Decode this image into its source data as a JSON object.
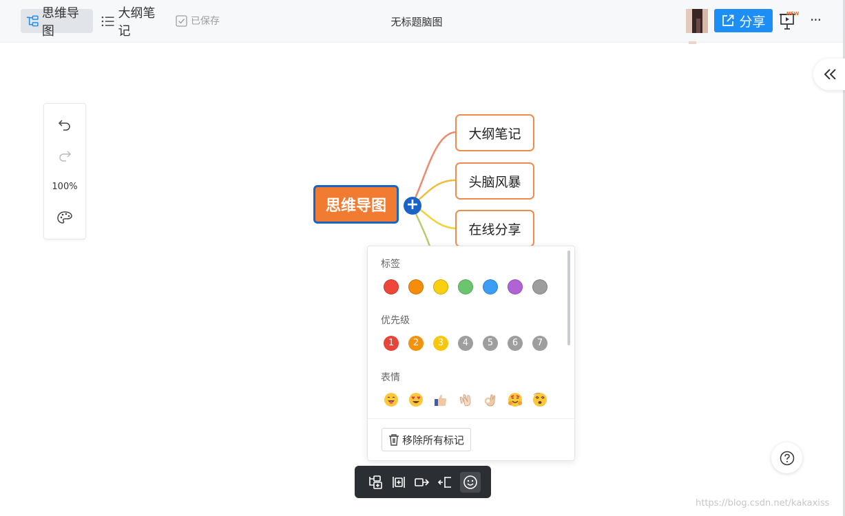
{
  "topbar": {
    "mindmap_tab": "思维导图",
    "outline_tab": "大纲笔记",
    "saved_status": "已保存",
    "doc_title": "无标题脑图",
    "share_label": "分享",
    "new_badge": "NEW",
    "more_label": "···"
  },
  "left_toolbar": {
    "zoom_level": "100%"
  },
  "mindmap": {
    "root": "思维导图",
    "children": [
      "大纲笔记",
      "头脑风暴",
      "在线分享"
    ]
  },
  "marker_panel": {
    "tags_title": "标签",
    "tag_colors": [
      "#f0453a",
      "#f58c0a",
      "#f9cf0f",
      "#6ac66c",
      "#3a9ef5",
      "#b163d6",
      "#9d9d9d"
    ],
    "priority_title": "优先级",
    "priorities": [
      "1",
      "2",
      "3",
      "4",
      "5",
      "6",
      "7"
    ],
    "priority_colors": [
      "#e8453a",
      "#f3920f",
      "#f8c70d",
      "#9e9e9e",
      "#9e9e9e",
      "#9e9e9e",
      "#9e9e9e"
    ],
    "emoji_title": "表情",
    "emojis": [
      "tongue-face-icon",
      "heart-eyes-icon",
      "thumbs-up-icon",
      "clapping-hands-icon",
      "ok-hand-icon",
      "hugging-face-icon",
      "dizzy-face-icon"
    ],
    "remove_label": "移除所有标记"
  },
  "bottom_toolbar": {
    "items": [
      "add-child-node",
      "add-sibling-node",
      "add-relation",
      "add-parent-node",
      "add-marker"
    ]
  },
  "watermark": "https://blog.csdn.net/kakaxiss"
}
